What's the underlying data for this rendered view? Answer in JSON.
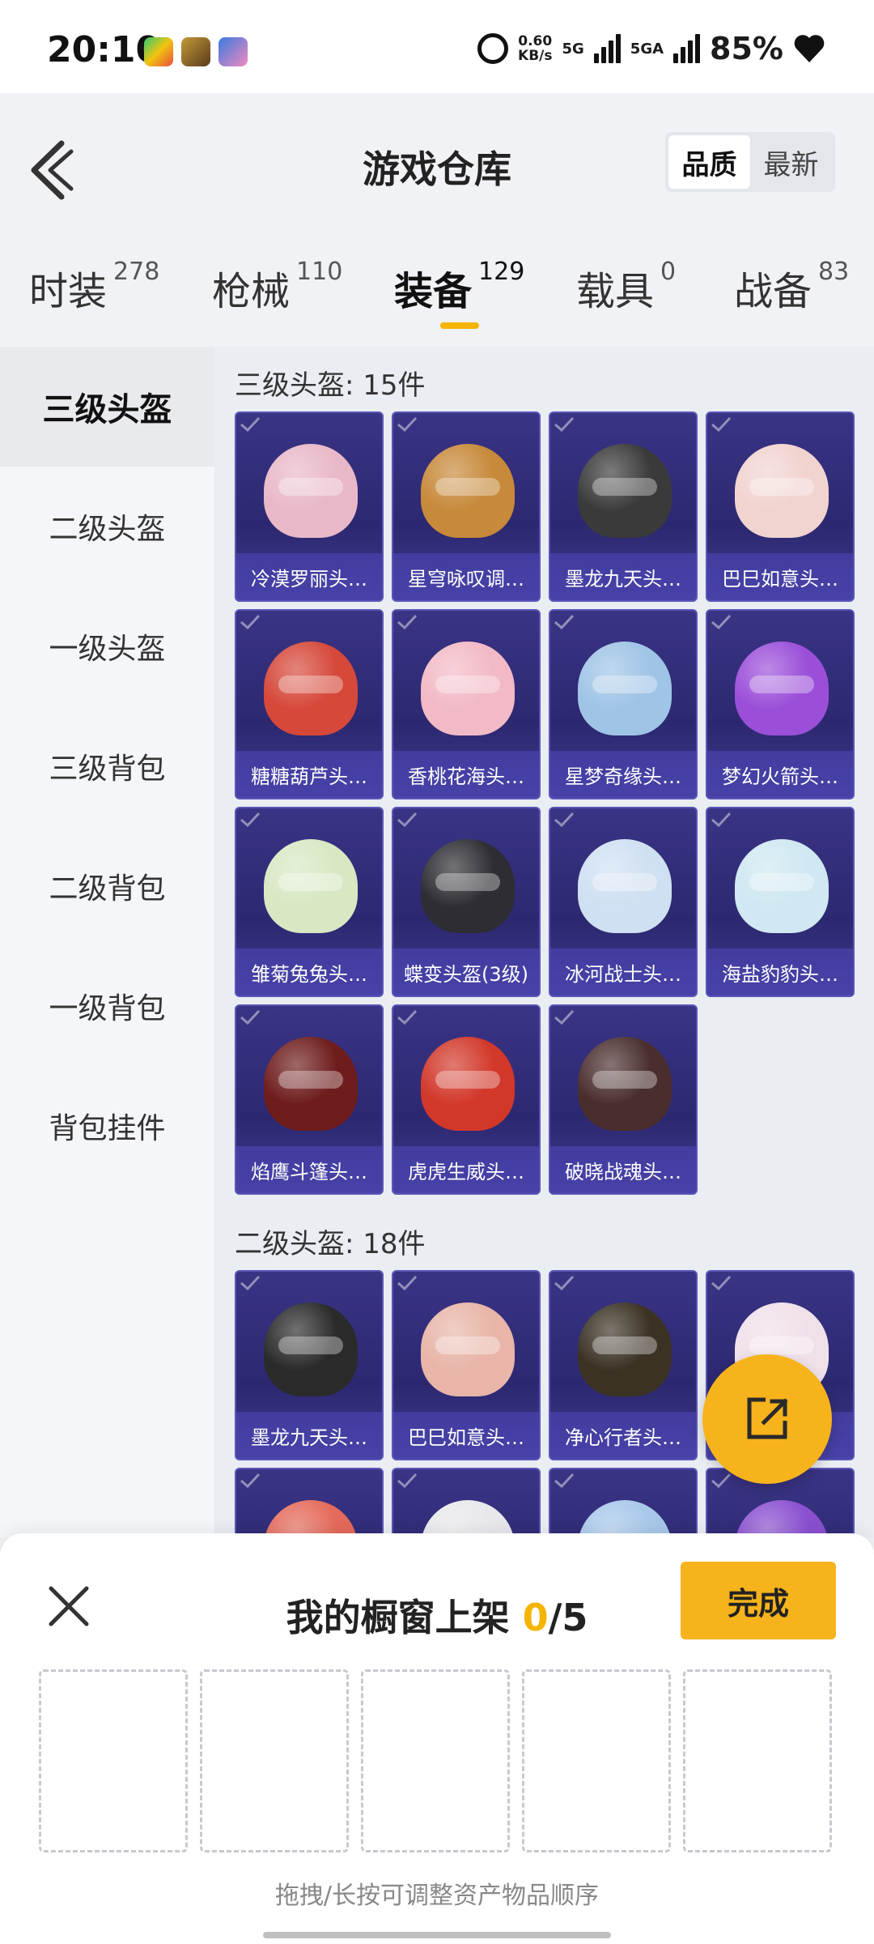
{
  "status_bar": {
    "time": "20:10",
    "net_speed": "0.60",
    "net_unit": "KB/s",
    "sig1_label": "5G",
    "sig2_label": "5GA",
    "battery": "85%"
  },
  "header": {
    "title": "游戏仓库",
    "sort_options": [
      "品质",
      "最新"
    ],
    "tabs": [
      {
        "label": "时装",
        "count": "278"
      },
      {
        "label": "枪械",
        "count": "110"
      },
      {
        "label": "装备",
        "count": "129"
      },
      {
        "label": "载具",
        "count": "0"
      },
      {
        "label": "战备",
        "count": "83"
      }
    ]
  },
  "sidebar": {
    "items": [
      "三级头盔",
      "二级头盔",
      "一级头盔",
      "三级背包",
      "二级背包",
      "一级背包",
      "背包挂件"
    ]
  },
  "sections": [
    {
      "title": "三级头盔: 15件",
      "items": [
        {
          "name": "冷漠罗丽头…",
          "color": "#e9b8c8"
        },
        {
          "name": "星穹咏叹调…",
          "color": "#c7893a"
        },
        {
          "name": "墨龙九天头…",
          "color": "#3a3a3a"
        },
        {
          "name": "巴巳如意头…",
          "color": "#f1d3cf"
        },
        {
          "name": "糖糖葫芦头…",
          "color": "#d6483a"
        },
        {
          "name": "香桃花海头…",
          "color": "#f2b9c6"
        },
        {
          "name": "星梦奇缘头…",
          "color": "#9fc4e6"
        },
        {
          "name": "梦幻火箭头…",
          "color": "#9b4fd9"
        },
        {
          "name": "雏菊兔兔头…",
          "color": "#d7e8c3"
        },
        {
          "name": "蝶变头盔(3级)",
          "color": "#2d2d33"
        },
        {
          "name": "冰河战士头…",
          "color": "#cfe0f2"
        },
        {
          "name": "海盐豹豹头…",
          "color": "#cfe8f2"
        },
        {
          "name": "焰鹰斗篷头…",
          "color": "#6e1c1c"
        },
        {
          "name": "虎虎生威头…",
          "color": "#d2382a"
        },
        {
          "name": "破晓战魂头…",
          "color": "#4a2e2e"
        }
      ]
    },
    {
      "title": "二级头盔: 18件",
      "items": [
        {
          "name": "墨龙九天头…",
          "color": "#2a2a2a"
        },
        {
          "name": "巴巳如意头…",
          "color": "#e8b5a8"
        },
        {
          "name": "净心行者头…",
          "color": "#3b3224"
        },
        {
          "name": "",
          "color": "#f0e0ea"
        },
        {
          "name": "",
          "color": "#e46a5a"
        },
        {
          "name": "",
          "color": "#e8e8ec"
        },
        {
          "name": "",
          "color": "#a8c8ea"
        },
        {
          "name": "",
          "color": "#8a50d0"
        }
      ]
    }
  ],
  "showcase": {
    "title_prefix": "我的橱窗上架 ",
    "count": "0",
    "total": "/5",
    "done_label": "完成",
    "hint": "拖拽/长按可调整资产物品顺序"
  }
}
